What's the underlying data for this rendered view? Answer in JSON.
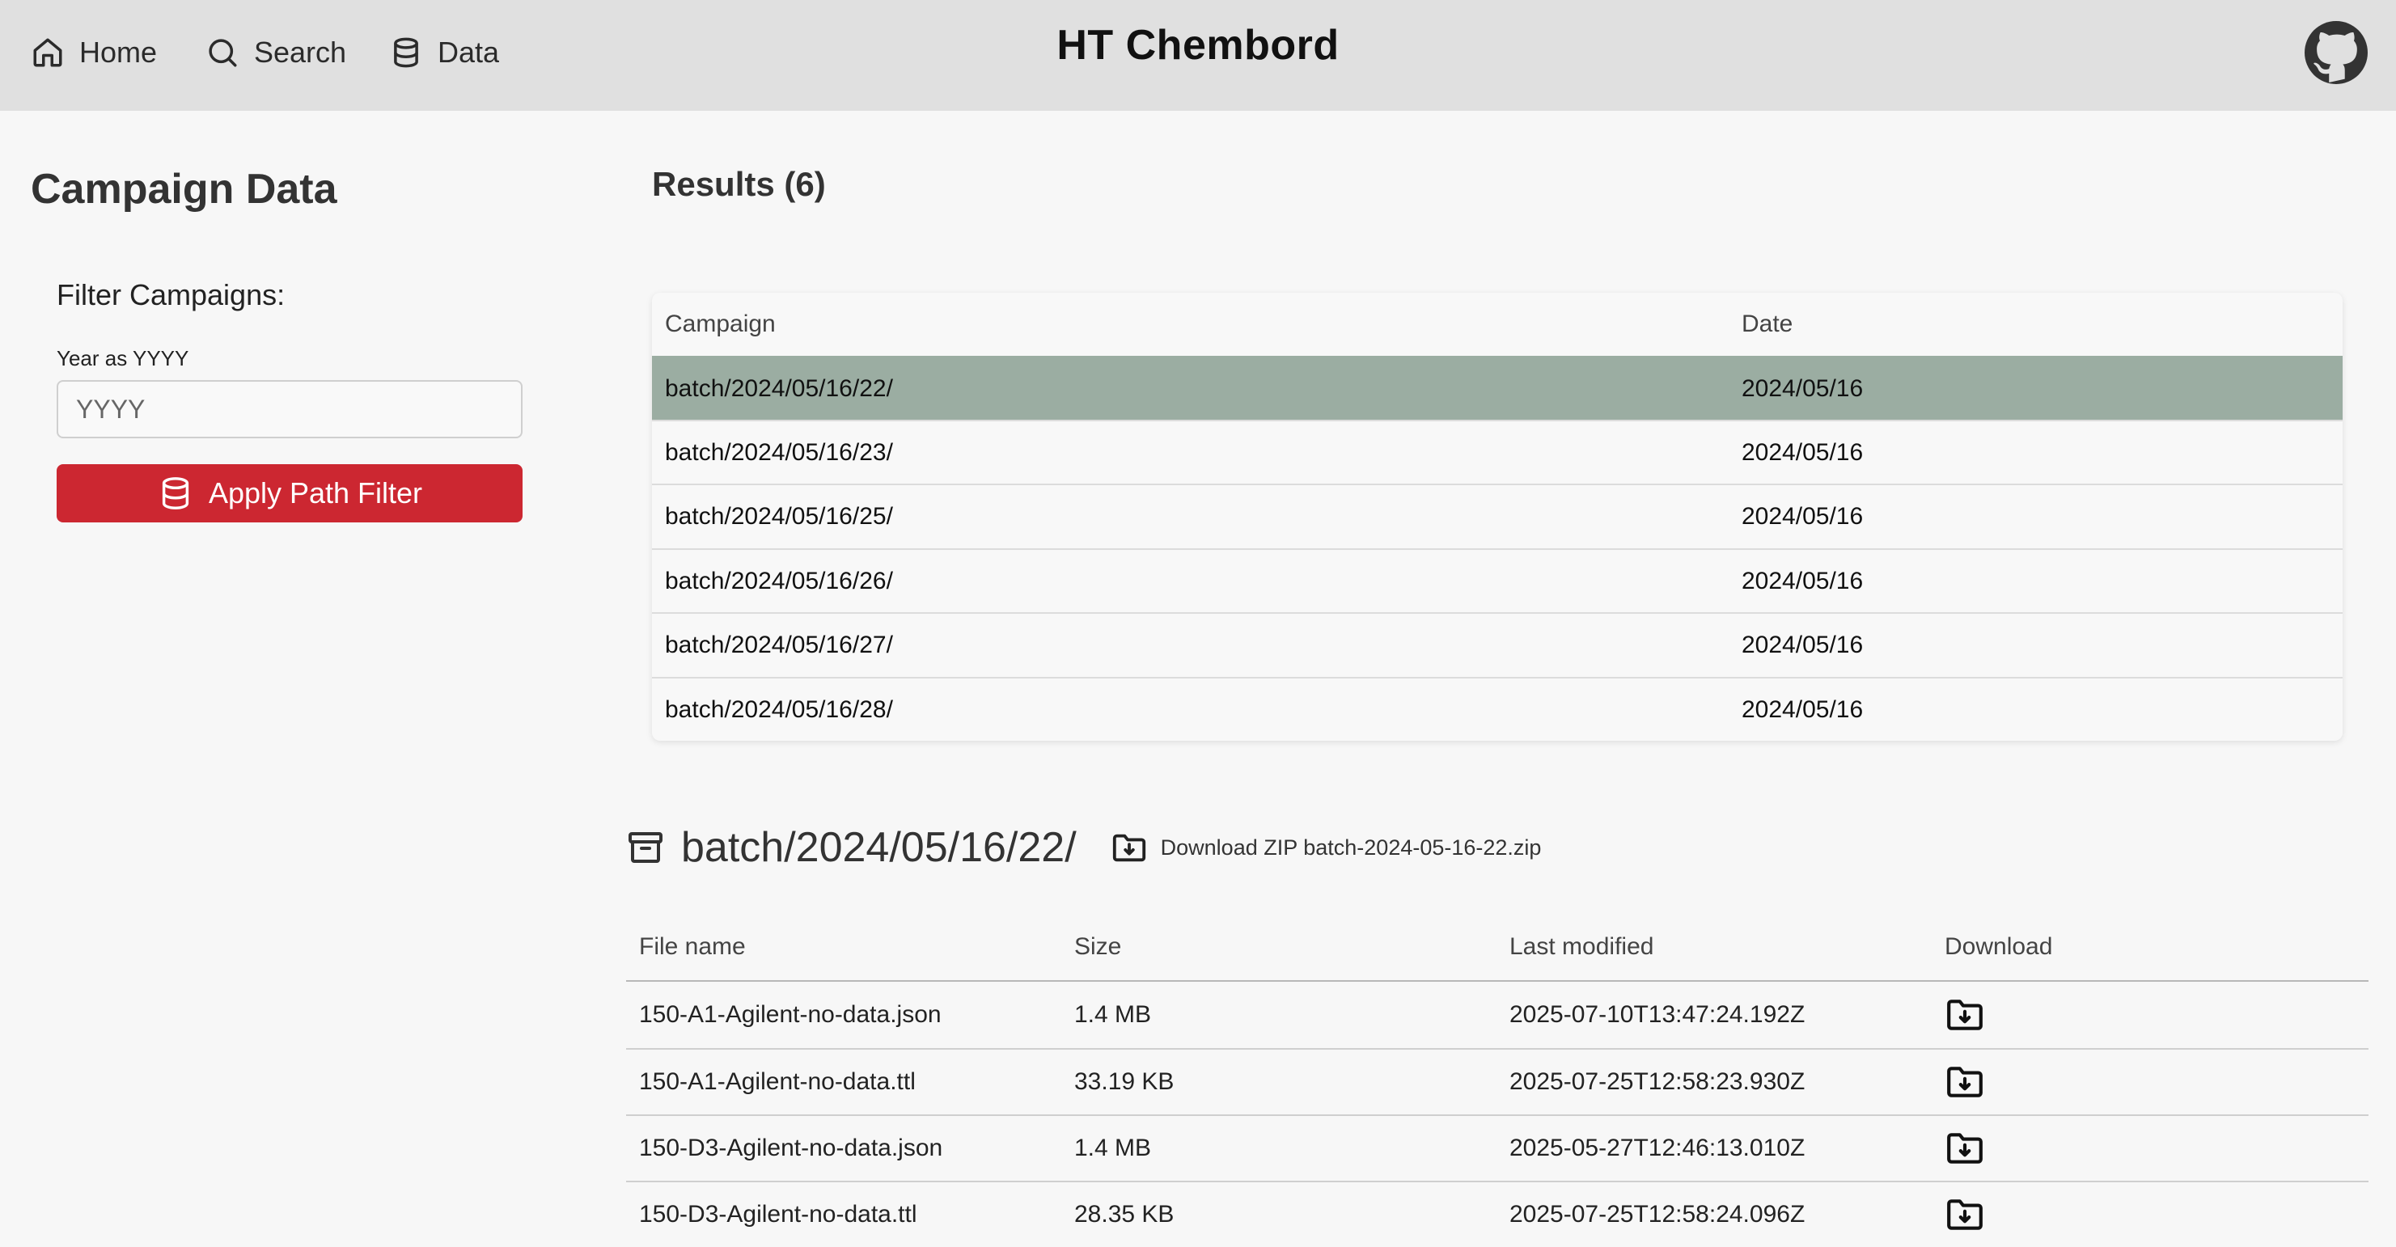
{
  "nav": {
    "items": [
      {
        "label": "Home",
        "icon": "home-icon"
      },
      {
        "label": "Search",
        "icon": "search-icon"
      },
      {
        "label": "Data",
        "icon": "database-icon"
      }
    ],
    "brand": "HT Chembord",
    "github_icon": "github-icon"
  },
  "sidebar": {
    "title": "Campaign Data",
    "filter_title": "Filter Campaigns:",
    "year_label": "Year as YYYY",
    "year_placeholder": "YYYY",
    "year_value": "",
    "apply_button": "Apply Path Filter"
  },
  "results": {
    "title": "Results (6)",
    "columns": [
      "Campaign",
      "Date"
    ],
    "rows": [
      {
        "campaign": "batch/2024/05/16/22/",
        "date": "2024/05/16",
        "selected": true
      },
      {
        "campaign": "batch/2024/05/16/23/",
        "date": "2024/05/16",
        "selected": false
      },
      {
        "campaign": "batch/2024/05/16/25/",
        "date": "2024/05/16",
        "selected": false
      },
      {
        "campaign": "batch/2024/05/16/26/",
        "date": "2024/05/16",
        "selected": false
      },
      {
        "campaign": "batch/2024/05/16/27/",
        "date": "2024/05/16",
        "selected": false
      },
      {
        "campaign": "batch/2024/05/16/28/",
        "date": "2024/05/16",
        "selected": false
      }
    ]
  },
  "batch": {
    "name": "batch/2024/05/16/22/",
    "download_zip": "Download ZIP batch-2024-05-16-22.zip",
    "columns": [
      "File name",
      "Size",
      "Last modified",
      "Download"
    ],
    "files": [
      {
        "name": "150-A1-Agilent-no-data.json",
        "size": "1.4 MB",
        "modified": "2025-07-10T13:47:24.192Z"
      },
      {
        "name": "150-A1-Agilent-no-data.ttl",
        "size": "33.19 KB",
        "modified": "2025-07-25T12:58:23.930Z"
      },
      {
        "name": "150-D3-Agilent-no-data.json",
        "size": "1.4 MB",
        "modified": "2025-05-27T12:46:13.010Z"
      },
      {
        "name": "150-D3-Agilent-no-data.ttl",
        "size": "28.35 KB",
        "modified": "2025-07-25T12:58:24.096Z"
      }
    ]
  },
  "colors": {
    "topbar": "#e0e0e0",
    "accent_red": "#cc2731",
    "selected_row": "#9bada2",
    "page_bg": "#f7f7f7"
  }
}
